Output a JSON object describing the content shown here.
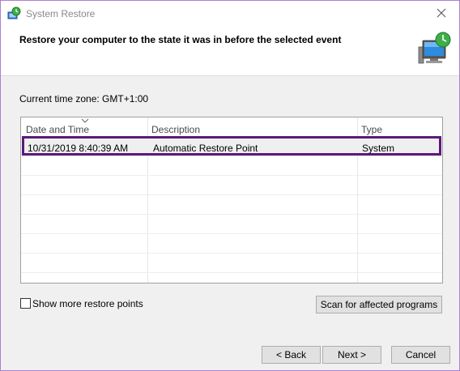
{
  "window": {
    "title": "System Restore",
    "accent_border": "#aa7fd6"
  },
  "header": {
    "title": "Restore your computer to the state it was in before the selected event",
    "icon": "system-restore-computer-icon"
  },
  "timezone": {
    "label": "Current time zone: GMT+1:00"
  },
  "restore_list": {
    "columns": [
      "Date and Time",
      "Description",
      "Type"
    ],
    "sorted_column": "Date and Time",
    "rows": [
      {
        "date_time": "10/31/2019 8:40:39 AM",
        "description": "Automatic Restore Point",
        "type": "System",
        "selected": true
      }
    ],
    "highlight_color": "#5b1a7a"
  },
  "options": {
    "show_more_label": "Show more restore points",
    "show_more_checked": false
  },
  "buttons": {
    "scan": "Scan for affected programs",
    "back": "< Back",
    "next": "Next >",
    "cancel": "Cancel"
  }
}
